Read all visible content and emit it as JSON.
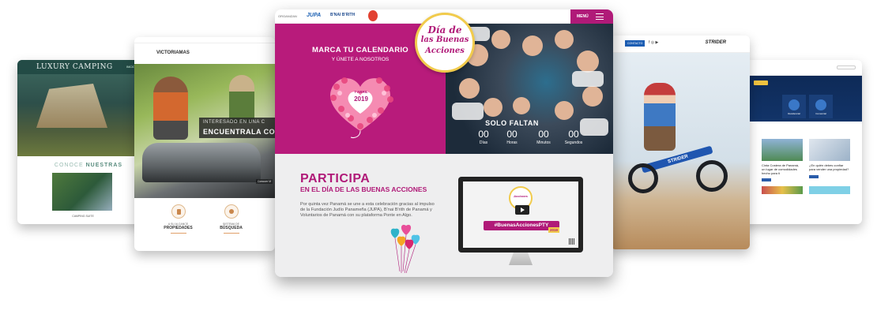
{
  "card1": {
    "brand": "LUXURY CAMPING",
    "nav_links": "INICIO   Quiénes somos",
    "hero_text": "VI",
    "section_title_a": "CONOCE",
    "section_title_b": "NUESTRAS",
    "thumb_caption": "CAMPING SUITE"
  },
  "card2": {
    "brand": "VICTORIAMAS",
    "banner_line1": "INTERESADO EN UNA C",
    "banner_line2": "ENCUENTRALA CO",
    "banner_link": "Conocer M",
    "features": [
      {
        "line1": "A SU ALCANCE",
        "line2": "PROPIEDADES"
      },
      {
        "line1": "SISTEMA DE",
        "line2": "BÚSQUEDA"
      }
    ]
  },
  "card3": {
    "org_label": "ORGANIZAN",
    "jupa": "JUPA",
    "bnai": "B'NAI B'RITH",
    "menu_label": "MENÚ",
    "logo": {
      "line1": "Día de",
      "line2": "las Buenas",
      "line3": "Acciones"
    },
    "marca": "MARCA TU CALENDARIO",
    "unete": "Y ÚNETE A NOSOTROS",
    "heart_date_day": "7 ABRIL",
    "heart_date_year": "2019",
    "countdown_title": "SOLO FALTAN",
    "countdown": [
      {
        "value": "00",
        "label": "Días"
      },
      {
        "value": "00",
        "label": "Horas"
      },
      {
        "value": "00",
        "label": "Minutos"
      },
      {
        "value": "00",
        "label": "Segundos"
      }
    ],
    "participa": "PARTICIPA",
    "participa_sub": "EN EL DÍA DE LAS BUENAS ACCIONES",
    "body": "Por quinta vez Panamá se une a esta celebración gracias al impulso de la Fundación Judío Panameña (JUPA), B'nai B'rith de Panamá y Voluntarios de Panamá con su plataforma Ponte en Algo.",
    "video_hashtag": "#BuenasAccionesPTY",
    "video_year": "2019"
  },
  "card4": {
    "contact": "CONTACTO",
    "brand": "STRIDER",
    "bike_label": "STRIDER"
  },
  "card5": {
    "tiles": [
      "Residencial",
      "Comercial"
    ],
    "items": [
      {
        "title": "Cinta Costera de Panamá, un lugar de comodidades hecho para ti"
      },
      {
        "title": "¿En quién debes confiar para vender una propiedad?"
      }
    ]
  },
  "colors": {
    "magenta": "#b81b7b",
    "gold": "#f1cb4c",
    "strider_blue": "#1f56b0",
    "navy": "#0e2a57"
  }
}
